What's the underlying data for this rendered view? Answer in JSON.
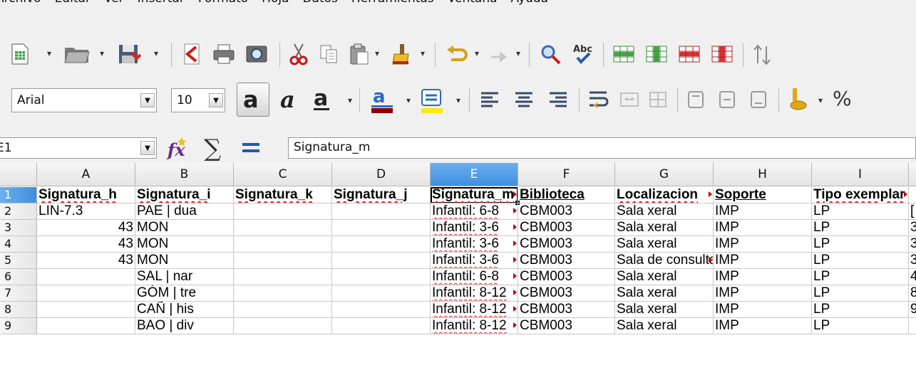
{
  "menu": [
    "Archivo",
    "Editar",
    "Ver",
    "Insertar",
    "Formato",
    "Hoja",
    "Datos",
    "Herramientas",
    "Ventana",
    "Ayuda"
  ],
  "font_name": "Arial",
  "font_size": "10",
  "name_box": "E1",
  "formula_content": "Signatura_m",
  "formula_icons": {
    "wizard": "function-wizard-icon",
    "sum": "sum-icon",
    "equals": "equals-icon"
  },
  "toolbar2_tail": "%",
  "columns": [
    "A",
    "B",
    "C",
    "D",
    "E",
    "F",
    "G",
    "H",
    "I"
  ],
  "rows": [
    {
      "num": "1",
      "cells": [
        "Signatura_h",
        "Signatura_i",
        "Signatura_k",
        "Signatura_j",
        "Signatura_m",
        "Biblioteca",
        "Localizacion",
        "Soporte",
        "Tipo exemplar"
      ]
    },
    {
      "num": "2",
      "cells": [
        "LIN-7.3",
        "PAE | dua",
        "",
        "",
        "Infantil: 6-8",
        "CBM003",
        "Sala xeral",
        "IMP",
        "LP"
      ]
    },
    {
      "num": "3",
      "cells": [
        "43",
        "MON",
        "",
        "",
        "Infantil: 3-6",
        "CBM003",
        "Sala xeral",
        "IMP",
        "LP"
      ]
    },
    {
      "num": "4",
      "cells": [
        "43",
        "MON",
        "",
        "",
        "Infantil: 3-6",
        "CBM003",
        "Sala xeral",
        "IMP",
        "LP"
      ]
    },
    {
      "num": "5",
      "cells": [
        "43",
        "MON",
        "",
        "",
        "Infantil: 3-6",
        "CBM003",
        "Sala de consulta",
        "IMP",
        "LP"
      ]
    },
    {
      "num": "6",
      "cells": [
        "",
        "SAL | nar",
        "",
        "",
        "Infantil: 6-8",
        "CBM003",
        "Sala xeral",
        "IMP",
        "LP"
      ]
    },
    {
      "num": "7",
      "cells": [
        "",
        "GÓM | tre",
        "",
        "",
        "Infantil: 8-12",
        "CBM003",
        "Sala xeral",
        "IMP",
        "LP"
      ]
    },
    {
      "num": "8",
      "cells": [
        "",
        "CAÑ | his",
        "",
        "",
        "Infantil: 8-12",
        "CBM003",
        "Sala xeral",
        "IMP",
        "LP"
      ]
    },
    {
      "num": "9",
      "cells": [
        "",
        "BAO | div",
        "",
        "",
        "Infantil: 8-12",
        "CBM003",
        "Sala xeral",
        "IMP",
        "LP"
      ]
    }
  ],
  "partial_column_j": [
    "[",
    "3",
    "3",
    "3",
    "4",
    "8",
    "9"
  ],
  "selected_cell": "E1"
}
